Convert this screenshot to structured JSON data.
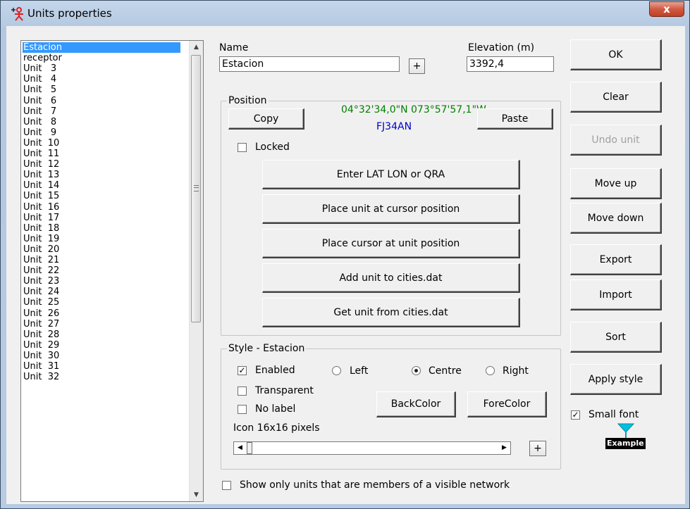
{
  "window": {
    "title": "Units properties",
    "close_label": "x"
  },
  "units": [
    "Estacion",
    "receptor",
    "Unit   3",
    "Unit   4",
    "Unit   5",
    "Unit   6",
    "Unit   7",
    "Unit   8",
    "Unit   9",
    "Unit  10",
    "Unit  11",
    "Unit  12",
    "Unit  13",
    "Unit  14",
    "Unit  15",
    "Unit  16",
    "Unit  17",
    "Unit  18",
    "Unit  19",
    "Unit  20",
    "Unit  21",
    "Unit  22",
    "Unit  23",
    "Unit  24",
    "Unit  25",
    "Unit  26",
    "Unit  27",
    "Unit  28",
    "Unit  29",
    "Unit  30",
    "Unit  31",
    "Unit  32"
  ],
  "selected_unit": "Estacion",
  "name": {
    "label": "Name",
    "value": "Estacion",
    "plus": "+"
  },
  "elevation": {
    "label": "Elevation (m)",
    "value": "3392,4"
  },
  "position": {
    "legend": "Position",
    "coords": "04°32'34,0\"N 073°57'57,1\"W",
    "locator": "FJ34AN",
    "copy": "Copy",
    "paste": "Paste",
    "locked": "Locked",
    "buttons": [
      "Enter LAT LON or QRA",
      "Place unit at cursor position",
      "Place cursor at unit position",
      "Add unit to cities.dat",
      "Get unit from cities.dat"
    ]
  },
  "style": {
    "legend": "Style - Estacion",
    "enabled": "Enabled",
    "transparent": "Transparent",
    "no_label": "No label",
    "left": "Left",
    "centre": "Centre",
    "right": "Right",
    "backcolor": "BackColor",
    "forecolor": "ForeColor",
    "icon_label": "Icon 16x16 pixels",
    "plus": "+"
  },
  "footer": {
    "show_only": "Show only units that are members of a visible network"
  },
  "right_buttons": {
    "ok": "OK",
    "clear": "Clear",
    "undo": "Undo unit",
    "move_up": "Move up",
    "move_down": "Move down",
    "export": "Export",
    "import": "Import",
    "sort": "Sort",
    "apply_style": "Apply style"
  },
  "small_font": {
    "label": "Small font",
    "example": "Example"
  },
  "colors": {
    "coords": "#008000",
    "locator": "#0000cc",
    "selection": "#3399ff",
    "icon_cyan": "#00c0e0"
  }
}
